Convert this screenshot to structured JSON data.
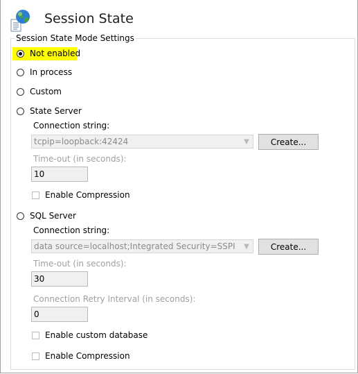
{
  "header": {
    "title": "Session State",
    "icon": "session-state-icon"
  },
  "group": {
    "legend": "Session State Mode Settings"
  },
  "modes": {
    "not_enabled": {
      "label": "Not enabled",
      "selected": true,
      "highlight_color": "#ffff00"
    },
    "in_process": {
      "label": "In process",
      "selected": false
    },
    "custom": {
      "label": "Custom",
      "selected": false
    },
    "state_server": {
      "label": "State Server",
      "selected": false
    },
    "sql_server": {
      "label": "SQL Server",
      "selected": false
    }
  },
  "state_server": {
    "connection_label": "Connection string:",
    "connection_value": "tcpip=loopback:42424",
    "create_label": "Create...",
    "timeout_label": "Time-out (in seconds):",
    "timeout_value": "10",
    "compression_label": "Enable Compression",
    "compression_checked": false
  },
  "sql_server": {
    "connection_label": "Connection string:",
    "connection_value": "data source=localhost;Integrated Security=SSPI",
    "create_label": "Create...",
    "timeout_label": "Time-out (in seconds):",
    "timeout_value": "30",
    "retry_label": "Connection Retry Interval (in seconds):",
    "retry_value": "0",
    "custom_db_label": "Enable custom database",
    "custom_db_checked": false,
    "compression_label": "Enable Compression",
    "compression_checked": false
  }
}
